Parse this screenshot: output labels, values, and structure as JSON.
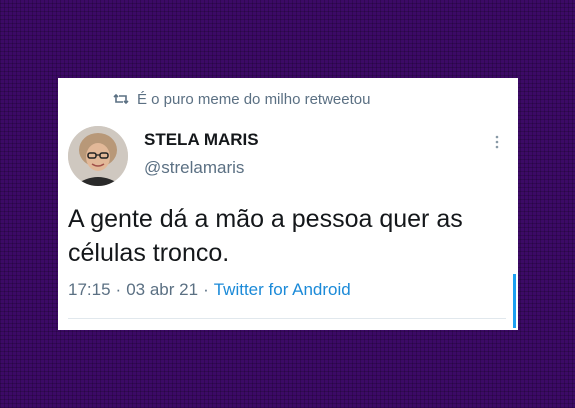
{
  "retweet": {
    "icon": "retweet-icon",
    "text": "É o puro meme do milho retweetou"
  },
  "author": {
    "avatar_icon": "profile-photo",
    "display_name": "STELA MARIS",
    "handle": "@strelamaris"
  },
  "tweet": {
    "text": "A gente dá a mão a pessoa quer as células tronco."
  },
  "meta": {
    "time": "17:15",
    "sep1": "·",
    "date": "03 abr 21",
    "sep2": "·",
    "source": "Twitter for Android"
  },
  "colors": {
    "background": "#3c0a66",
    "link": "#1b8ad8",
    "secondary_text": "#5b7083"
  }
}
